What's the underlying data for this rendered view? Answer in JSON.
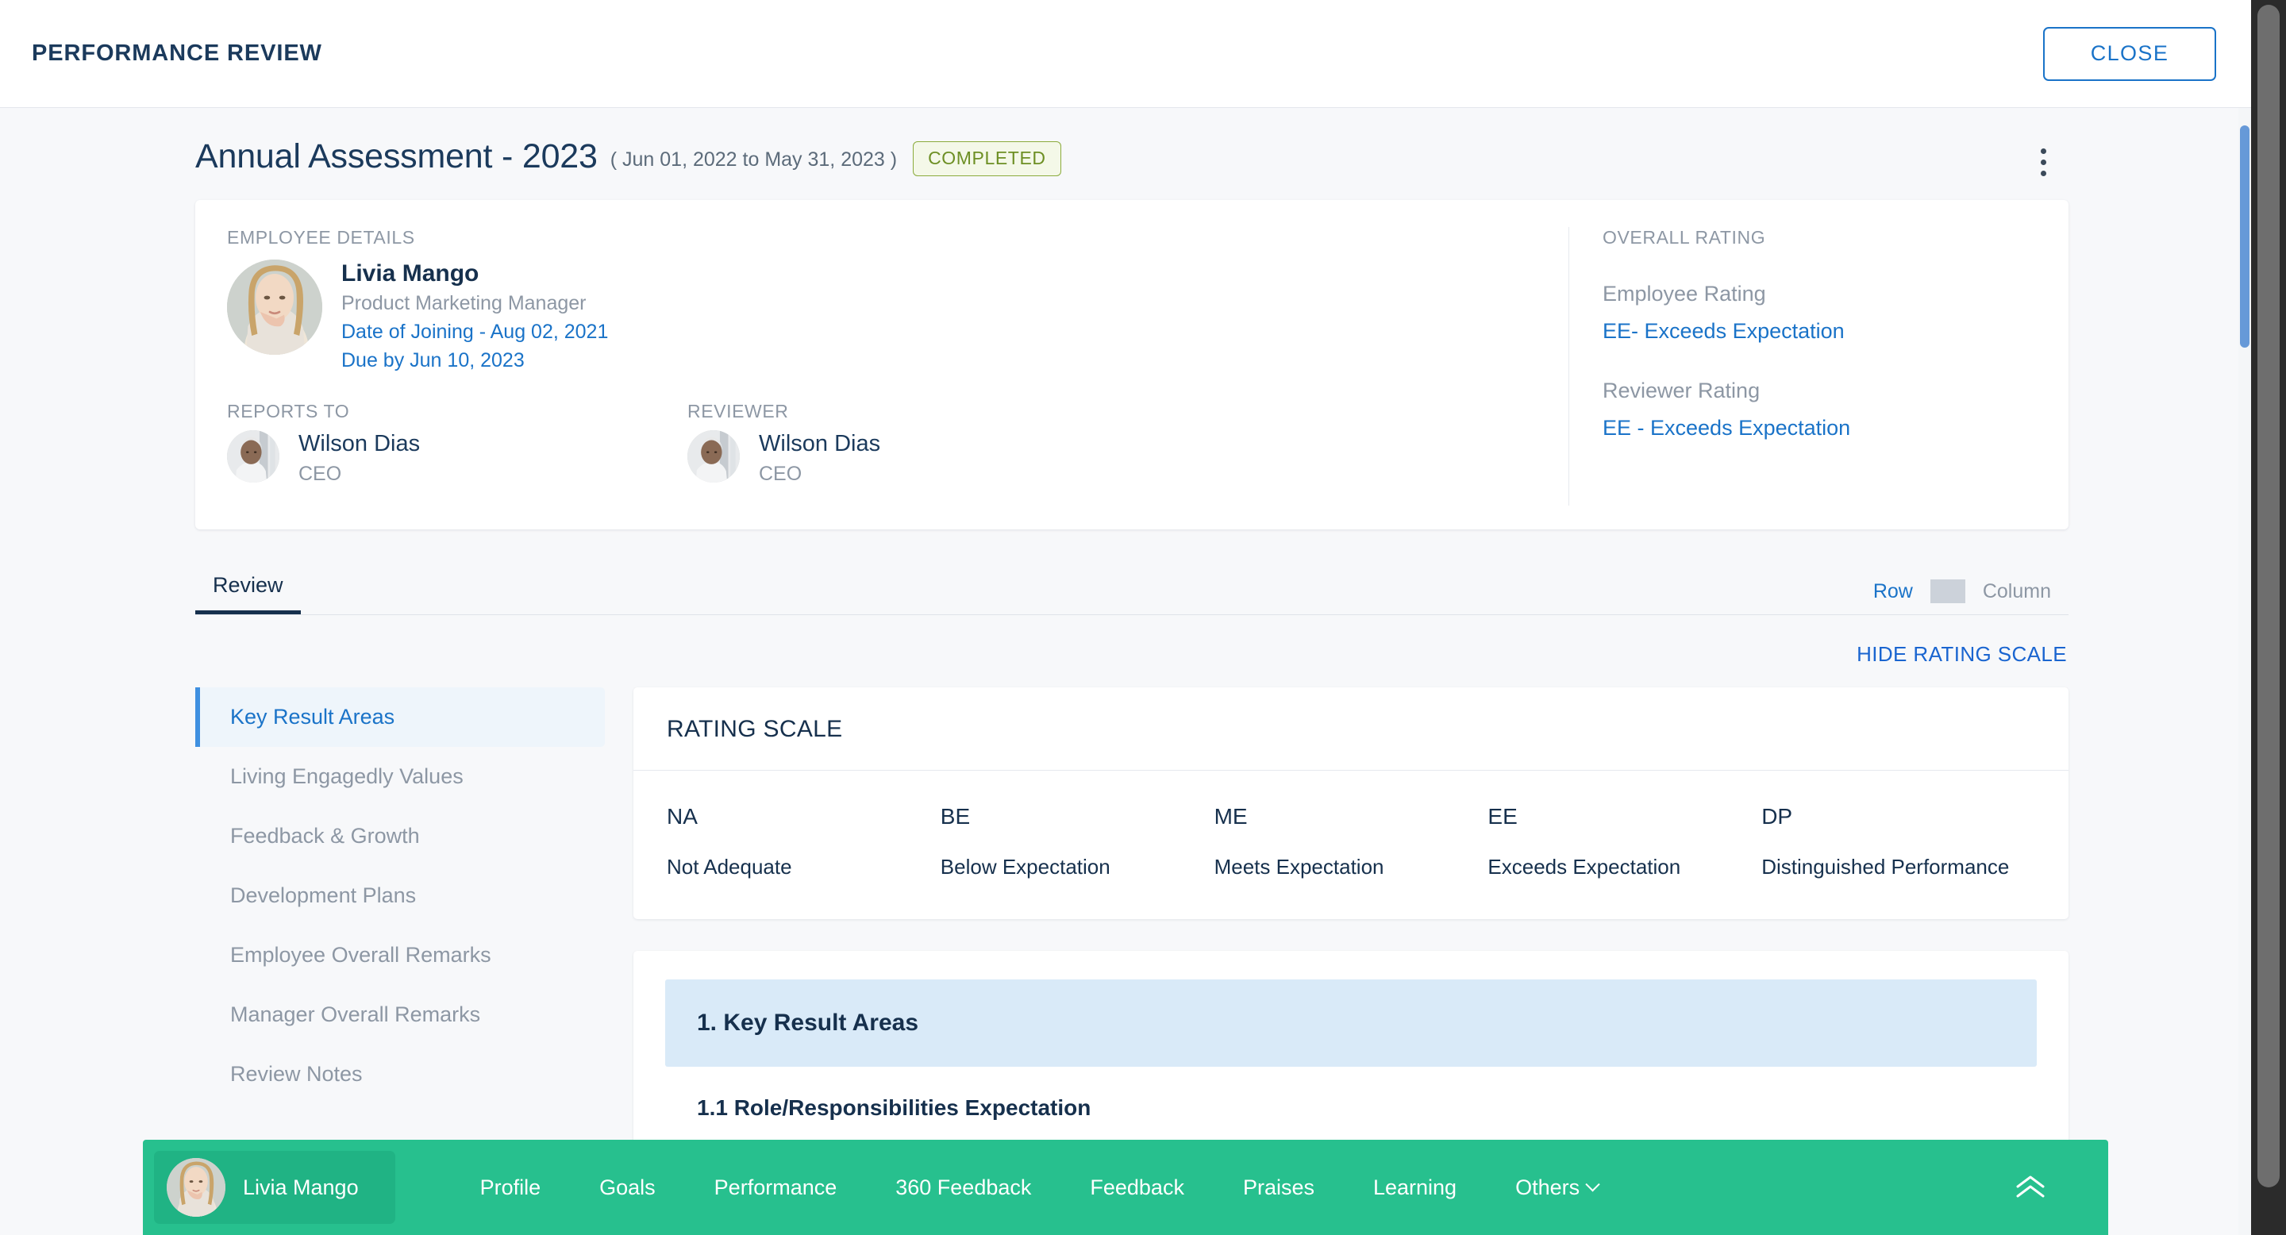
{
  "topbar": {
    "title": "PERFORMANCE REVIEW",
    "close_label": "CLOSE"
  },
  "review": {
    "title": "Annual Assessment - 2023",
    "date_range": "( Jun 01, 2022 to May 31, 2023 )",
    "status": "COMPLETED",
    "more_menu_icon": "kebab-menu-icon"
  },
  "employee_details": {
    "label": "EMPLOYEE DETAILS",
    "name": "Livia Mango",
    "role": "Product Marketing Manager",
    "date_of_joining": "Date of Joining - Aug 02, 2021",
    "due_by": "Due by Jun 10, 2023"
  },
  "reports_to": {
    "label": "REPORTS TO",
    "name": "Wilson Dias",
    "role": "CEO"
  },
  "reviewer": {
    "label": "REVIEWER",
    "name": "Wilson Dias",
    "role": "CEO"
  },
  "overall_rating": {
    "label": "OVERALL RATING",
    "employee_rating_label": "Employee Rating",
    "employee_rating_value": "EE- Exceeds Expectation",
    "reviewer_rating_label": "Reviewer Rating",
    "reviewer_rating_value": "EE - Exceeds Expectation"
  },
  "tabs": [
    {
      "label": "Review",
      "active": true
    }
  ],
  "view_toggle": {
    "row_label": "Row",
    "column_label": "Column",
    "active": "Row"
  },
  "hide_rating_scale_label": "HIDE RATING SCALE",
  "sidenav": {
    "items": [
      {
        "label": "Key Result Areas",
        "active": true
      },
      {
        "label": "Living Engagedly Values",
        "active": false
      },
      {
        "label": "Feedback & Growth",
        "active": false
      },
      {
        "label": "Development Plans",
        "active": false
      },
      {
        "label": "Employee Overall Remarks",
        "active": false
      },
      {
        "label": "Manager Overall Remarks",
        "active": false
      },
      {
        "label": "Review Notes",
        "active": false
      }
    ]
  },
  "rating_scale": {
    "heading": "RATING SCALE",
    "items": [
      {
        "code": "NA",
        "desc": "Not Adequate"
      },
      {
        "code": "BE",
        "desc": "Below Expectation"
      },
      {
        "code": "ME",
        "desc": "Meets Expectation"
      },
      {
        "code": "EE",
        "desc": "Exceeds Expectation"
      },
      {
        "code": "DP",
        "desc": "Distinguished Performance"
      }
    ]
  },
  "kra_section": {
    "banner_title": "1. Key Result Areas",
    "sub_title": "1.1 Role/Responsibilities Expectation"
  },
  "footer": {
    "user_name": "Livia Mango",
    "nav": [
      {
        "label": "Profile",
        "caret": false
      },
      {
        "label": "Goals",
        "caret": false
      },
      {
        "label": "Performance",
        "caret": false
      },
      {
        "label": "360 Feedback",
        "caret": false
      },
      {
        "label": "Feedback",
        "caret": false
      },
      {
        "label": "Praises",
        "caret": false
      },
      {
        "label": "Learning",
        "caret": false
      },
      {
        "label": "Others",
        "caret": true
      }
    ],
    "collapse_icon": "double-chevron-up-icon"
  },
  "colors": {
    "accent_blue": "#1a73c8",
    "navy": "#16304d",
    "green_badge": "#6d8f24",
    "footer_green": "#27c08e",
    "banner_blue": "#d9eaf8"
  }
}
